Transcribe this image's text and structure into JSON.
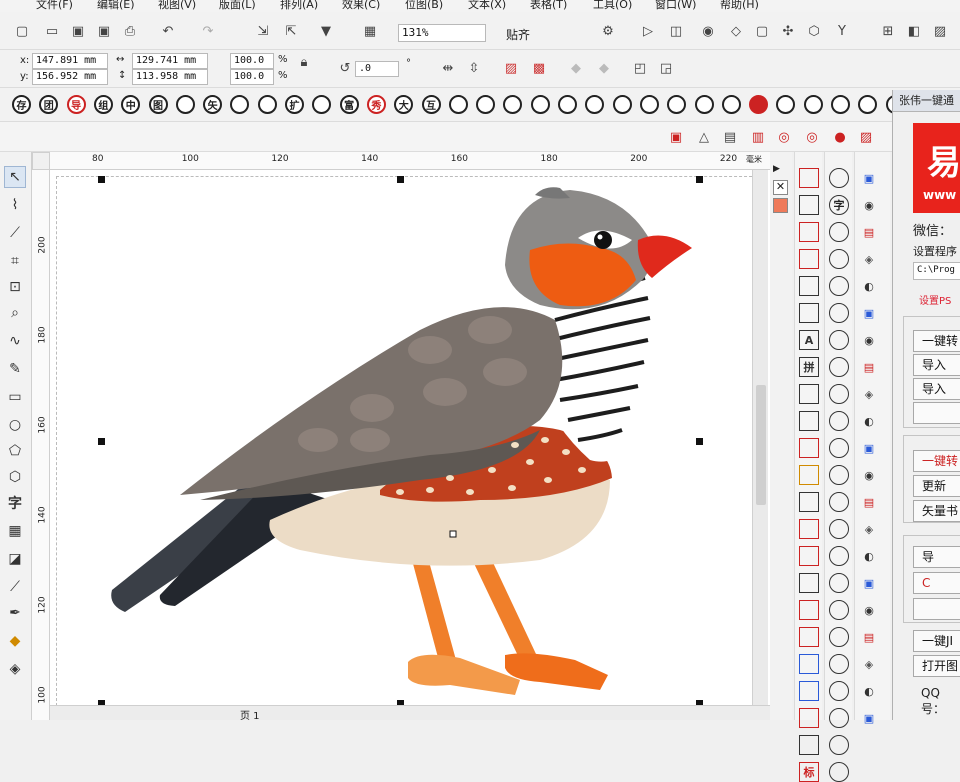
{
  "menu": [
    "文件(F)",
    "编辑(E)",
    "视图(V)",
    "版面(L)",
    "排列(A)",
    "效果(C)",
    "位图(B)",
    "文本(X)",
    "表格(T)",
    "工具(O)",
    "窗口(W)",
    "帮助(H)"
  ],
  "toolbar": {
    "zoom": "131%",
    "snap_label": "贴齐"
  },
  "propbar": {
    "x_label": "x:",
    "x_value": "147.891 mm",
    "y_label": "y:",
    "y_value": "156.952 mm",
    "w_value": "129.741 mm",
    "h_value": "113.958 mm",
    "scale_w": "100.0",
    "scale_h": "100.0",
    "percent": "%",
    "rotation": ".0",
    "degree": "°"
  },
  "symbol_row": [
    "存",
    "团",
    "导",
    "组",
    "中",
    "图",
    "",
    "矢",
    "",
    "",
    "扩",
    "",
    "富",
    "秀",
    "大",
    "互",
    "",
    "",
    "",
    "",
    "",
    "",
    "",
    "",
    "",
    "",
    "",
    "",
    "",
    "",
    "",
    "",
    ""
  ],
  "ruler_top": [
    "80",
    "100",
    "120",
    "140",
    "160",
    "180",
    "200",
    "220"
  ],
  "ruler_unit": "毫米",
  "ruler_left": [
    "200",
    "180",
    "160",
    "140",
    "120",
    "100"
  ],
  "plugin_col1": [
    "",
    "",
    "",
    "",
    "",
    "",
    "A",
    "拼",
    "",
    "",
    "",
    "",
    "",
    "",
    "",
    "",
    "",
    "",
    "",
    "",
    "",
    "",
    "标"
  ],
  "plugin_col2": [
    "",
    "字",
    "",
    "",
    "",
    "",
    "",
    "",
    "",
    "",
    "",
    "",
    "",
    "",
    "",
    "",
    "",
    "",
    "",
    "",
    "",
    "",
    ""
  ],
  "docker": {
    "title": "张伟一键通",
    "logo_text": "易",
    "logo_sub": "www",
    "wechat": "微信：",
    "setup": "设置程序",
    "path": "C:\\Prog",
    "set_ps": "设置PS",
    "btn1": "一键转",
    "btn2": "导入",
    "btn3": "导入",
    "btn4": "一键转",
    "btn5": "更新",
    "btn6": "矢量书",
    "btn7": "导",
    "btn8": "C",
    "btn9": "一键JI",
    "btn10": "打开图",
    "qq": "QQ号："
  },
  "pagebar": {
    "page_label": "页 1"
  },
  "colors": {
    "canvas": "#ffffff",
    "accent_red": "#e03020",
    "logo_red": "#e8231c"
  }
}
